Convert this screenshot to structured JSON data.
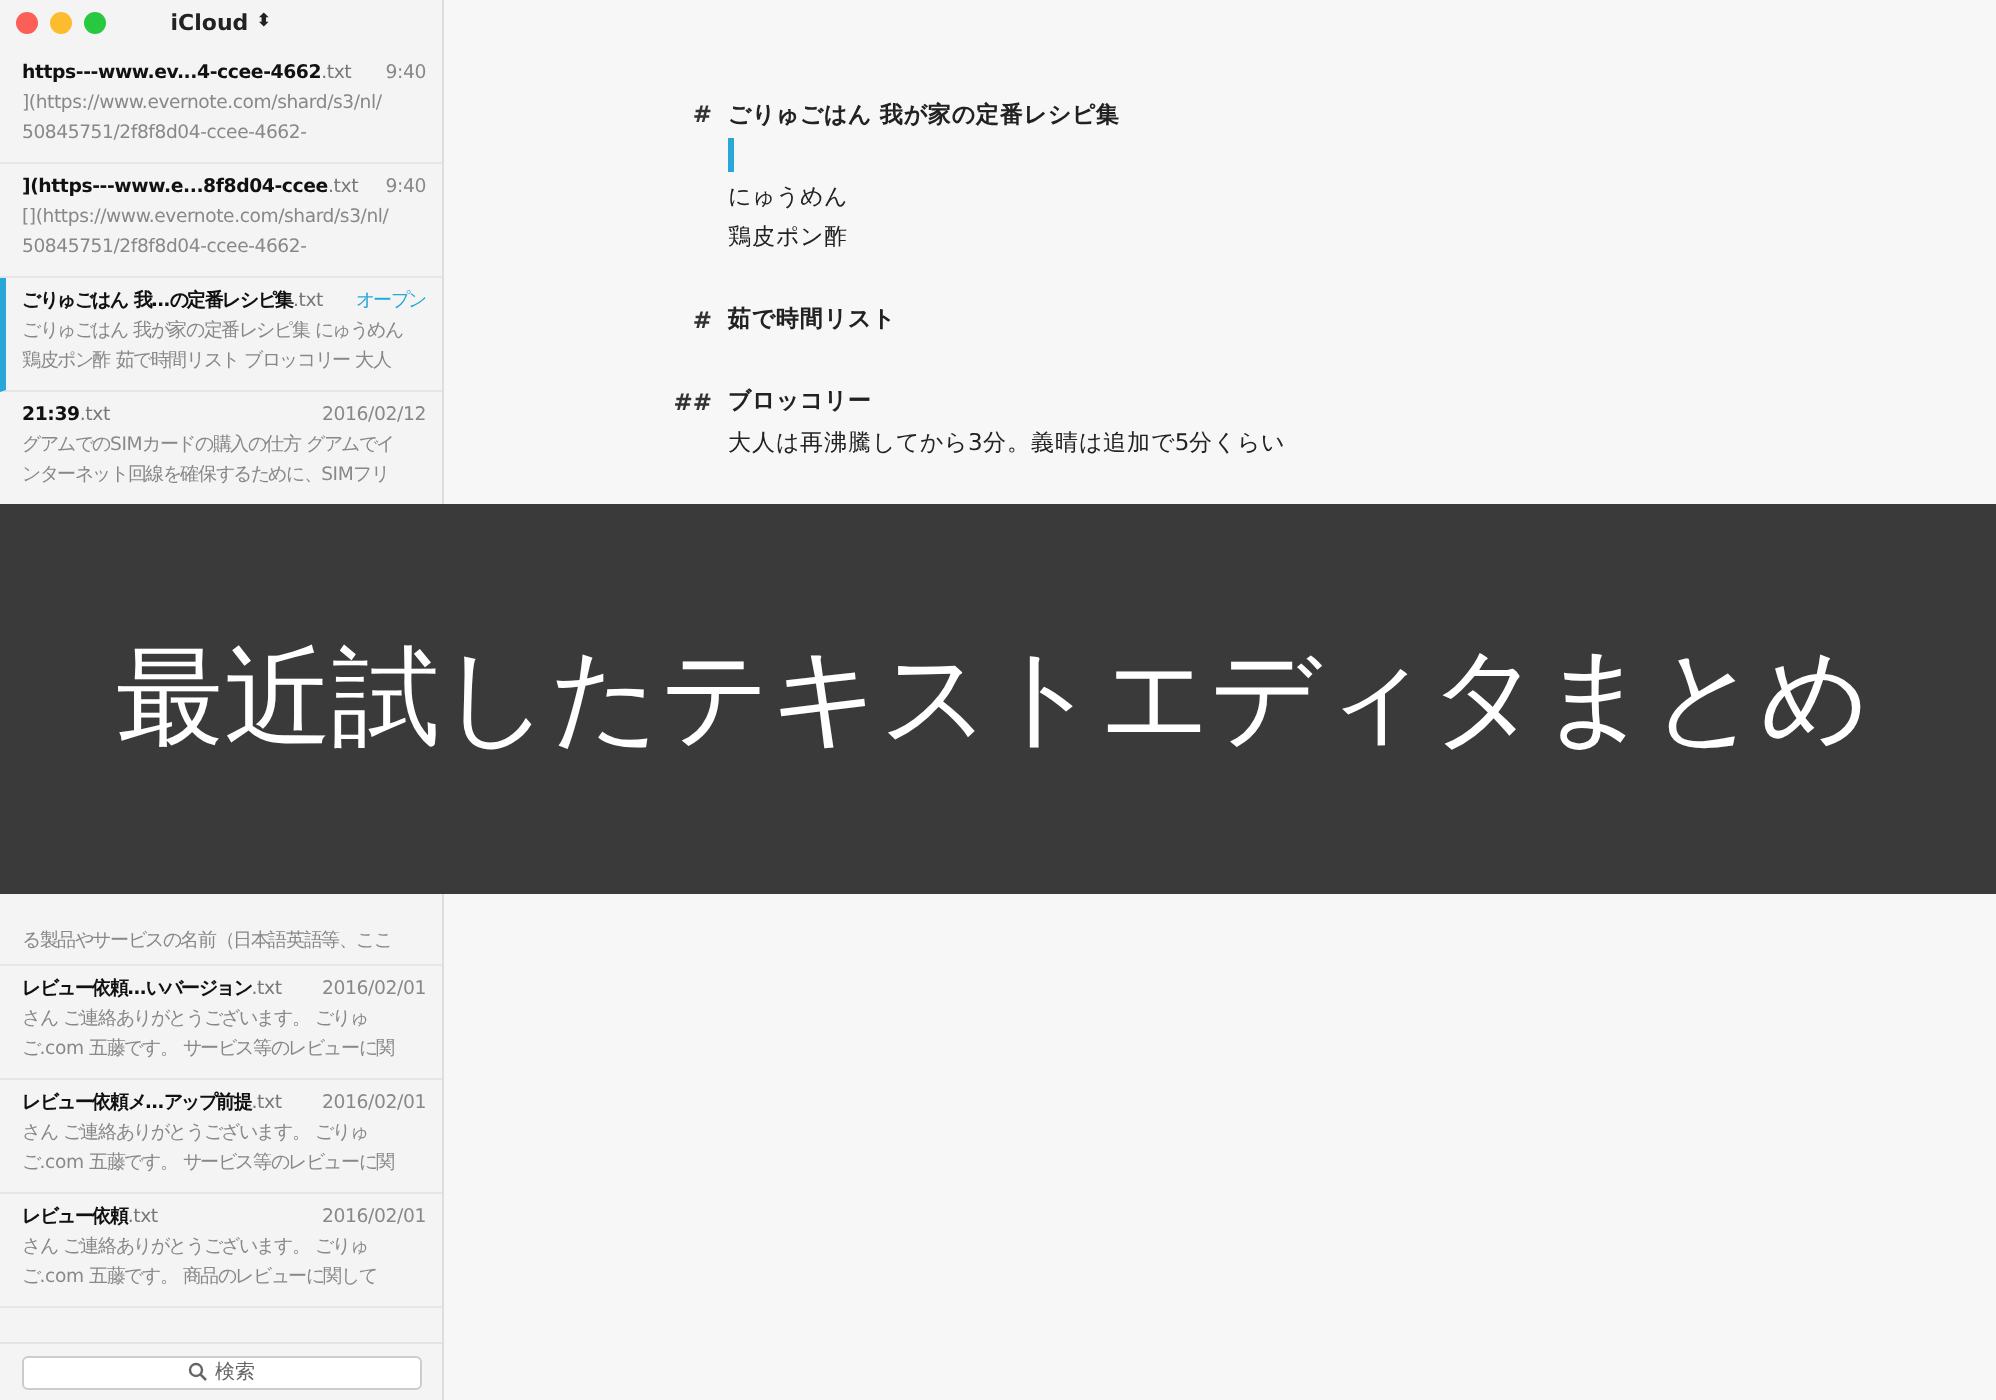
{
  "sidebar_top": {
    "account": "iCloud",
    "account_caret": "⬍",
    "items": [
      {
        "name": "https---www.ev...4-ccee-4662",
        "ext": ".txt",
        "date": "9:40",
        "preview": [
          "](https://www.evernote.com/shard/s3/nl/",
          "50845751/2f8f8d04-ccee-4662-"
        ],
        "selected": false
      },
      {
        "name": "](https---www.e...8f8d04-ccee",
        "ext": ".txt",
        "date": "9:40",
        "preview": [
          "[](https://www.evernote.com/shard/s3/nl/",
          "50845751/2f8f8d04-ccee-4662-"
        ],
        "selected": false
      },
      {
        "name": "ごりゅごはん 我…の定番レシピ集",
        "ext": ".txt",
        "date": "オープン",
        "preview": [
          "ごりゅごはん 我が家の定番レシピ集 にゅうめん",
          "鶏皮ポン酢 茹で時間リスト ブロッコリー 大人"
        ],
        "selected": true
      },
      {
        "name": "21:39",
        "ext": ".txt",
        "date": "2016/02/12",
        "preview": [
          "グアムでのSIMカードの購入の仕方 グアムでイ",
          "ンターネット回線を確保するために、SIMフリ"
        ],
        "selected": false
      }
    ]
  },
  "editor": {
    "lines": [
      {
        "kind": "heading",
        "marker": "#",
        "text": "ごりゅごはん  我が家の定番レシピ集"
      },
      {
        "kind": "cursor"
      },
      {
        "kind": "text",
        "text": "にゅうめん"
      },
      {
        "kind": "text",
        "text": "鶏皮ポン酢"
      },
      {
        "kind": "blank"
      },
      {
        "kind": "heading",
        "marker": "#",
        "text": "茹で時間リスト"
      },
      {
        "kind": "blank"
      },
      {
        "kind": "heading",
        "marker": "##",
        "text": "ブロッコリー"
      },
      {
        "kind": "text",
        "text": "大人は再沸騰してから3分。義晴は追加で5分くらい"
      }
    ]
  },
  "banner": {
    "title": "最近試したテキストエディタまとめ"
  },
  "sidebar_bottom": {
    "items": [
      {
        "preview": [
          "る製品やサービスの名前（日本語英語等、ここ"
        ],
        "selected": false
      },
      {
        "name": "レビュー依頼…いバージョン",
        "ext": ".txt",
        "date": "2016/02/01",
        "preview": [
          "さん ご連絡ありがとうございます。 ごりゅ",
          "ご.com 五藤です。 サービス等のレビューに関"
        ],
        "selected": false
      },
      {
        "name": "レビュー依頼メ…アップ前提",
        "ext": ".txt",
        "date": "2016/02/01",
        "preview": [
          "さん ご連絡ありがとうございます。 ごりゅ",
          "ご.com 五藤です。 サービス等のレビューに関"
        ],
        "selected": false
      },
      {
        "name": "レビュー依頼",
        "ext": ".txt",
        "date": "2016/02/01",
        "preview": [
          "さん ご連絡ありがとうございます。 ごりゅ",
          "ご.com 五藤です。 商品のレビューに関して"
        ],
        "selected": false
      }
    ],
    "search": {
      "placeholder": "検索"
    }
  }
}
